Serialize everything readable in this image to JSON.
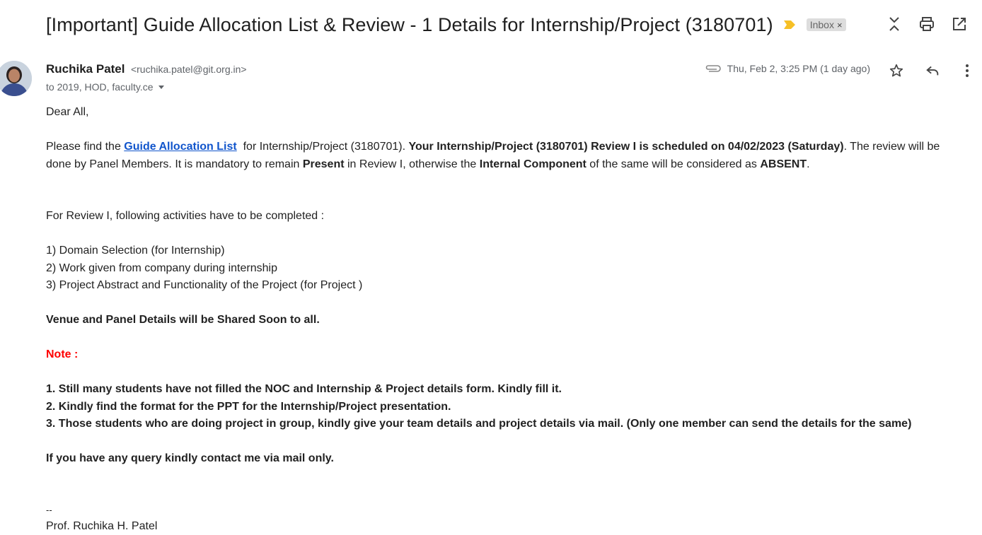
{
  "email": {
    "subject": "[Important] Guide Allocation List & Review - 1 Details for Internship/Project (3180701)",
    "label": "Inbox",
    "label_close": "×"
  },
  "sender": {
    "name": "Ruchika Patel",
    "email": "<ruchika.patel@git.org.in>",
    "recipients": "to 2019, HOD, faculty.ce",
    "date": "Thu, Feb 2, 3:25 PM (1 day ago)"
  },
  "message": {
    "greeting": "Dear All,",
    "p1": {
      "pre_link": "Please find the ",
      "link": "Guide Allocation List",
      "after_link": "  for Internship/Project (3180701). ",
      "bold_schedule": "Your Internship/Project (3180701) Review I is scheduled on 04/02/2023 (Saturday)",
      "after_schedule": ". The review will be done by Panel Members. It is mandatory to remain ",
      "bold_present": "Present",
      "mid": " in Review I, otherwise the ",
      "bold_internal": "Internal Component",
      "mid2": " of the same will be considered as ",
      "bold_absent": "ABSENT",
      "end": "."
    },
    "activities_intro": "For Review I, following activities have to be completed :",
    "activities": [
      "1) Domain Selection (for Internship)",
      "2) Work given from company during internship",
      "3) Project Abstract and Functionality of the Project (for Project )"
    ],
    "venue": "Venue and Panel Details will be Shared Soon to all.",
    "note_label": "Note :",
    "notes": [
      "1. Still many students have not filled the NOC and Internship & Project details form. Kindly fill it.",
      "2. Kindly find the format for the PPT for the Internship/Project presentation.",
      "3. Those students who are doing project in group, kindly give your team details and project details via mail. (Only one member can send the details for the same)"
    ],
    "contact": "If you have any query kindly contact me via mail only.",
    "sig_sep": "--",
    "signature": "Prof. Ruchika H. Patel"
  },
  "icons": {
    "importance": "importance-marker-icon",
    "expand": "expand-collapse-icon",
    "print": "print-icon",
    "new_window": "open-in-new-window-icon",
    "attachment": "attachment-icon",
    "star": "star-icon",
    "reply": "reply-icon",
    "more": "more-vert-icon",
    "recipient_caret": "caret-down-icon"
  },
  "colors": {
    "link": "#1155cc",
    "note": "#ff0000",
    "importance": "#f6c026",
    "chip_bg": "#dddddd"
  }
}
